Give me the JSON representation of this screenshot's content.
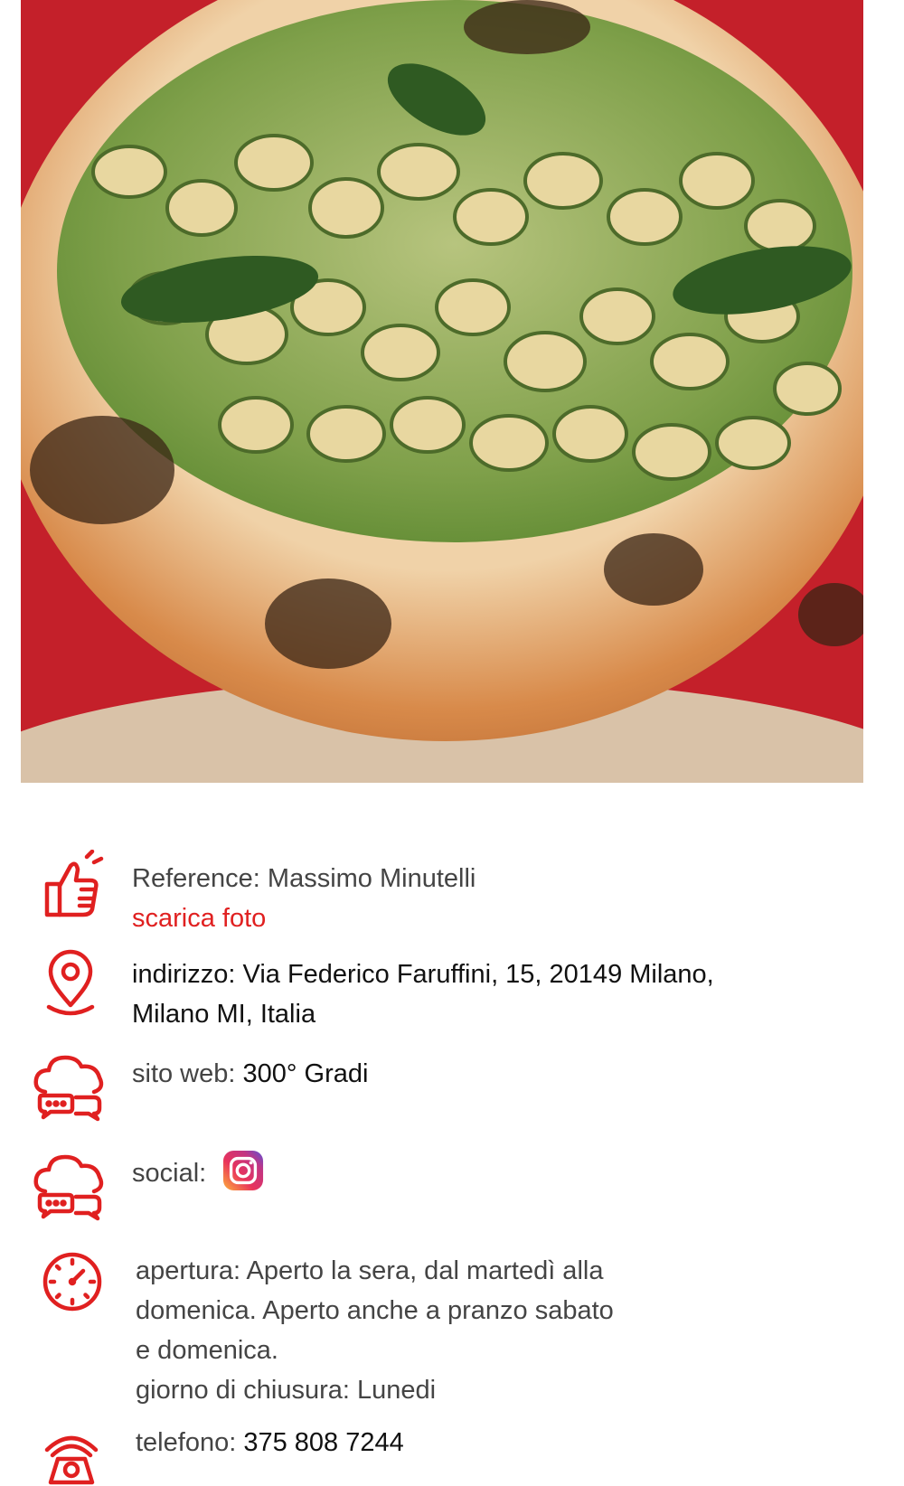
{
  "photo": {
    "alt_icon": "pizza-photo",
    "colors": {
      "background": "#c4202a",
      "crust": "#d88a4a",
      "pesto": "#7fa04a",
      "zucchini": "#e8d7a0"
    }
  },
  "info": {
    "reference": {
      "icon": "thumbs-up-icon",
      "label": "Reference: Massimo Minutelli",
      "download_link": "scarica foto"
    },
    "address": {
      "icon": "location-pin-icon",
      "label": "indirizzo: ",
      "value_line1": "Via Federico Faruffini, 15, 20149 Milano,",
      "value_line2": "Milano MI, Italia"
    },
    "website": {
      "icon": "chat-cloud-icon",
      "label": "sito web: ",
      "value": "300° Gradi"
    },
    "social": {
      "icon": "chat-cloud-icon",
      "label": "social: ",
      "instagram_icon": "instagram-icon"
    },
    "opening": {
      "icon": "clock-icon",
      "line1": "apertura: Aperto la sera, dal martedì alla",
      "line2": "domenica. Aperto anche a pranzo sabato",
      "line3": "e domenica.",
      "line4": "giorno di chiusura: Lunedi"
    },
    "phone": {
      "icon": "phone-icon",
      "label": "telefono: ",
      "value": "375 808 7244"
    }
  },
  "colors": {
    "accent": "#e02020",
    "text": "#222222"
  }
}
